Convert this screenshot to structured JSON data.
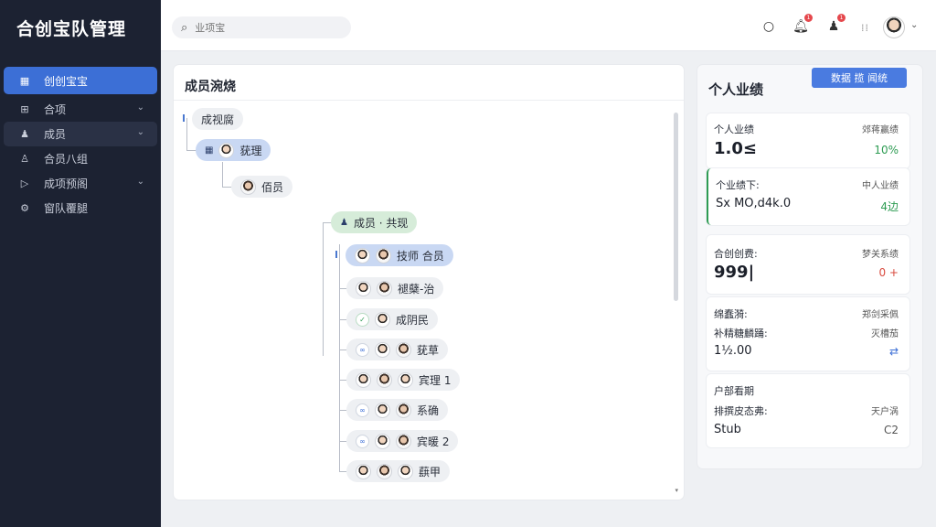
{
  "app": {
    "title": "合创宝队管理"
  },
  "sidebar": {
    "items": [
      {
        "label": "创创宝宝",
        "icon": "grid-icon"
      },
      {
        "label": "合项",
        "icon": "table-icon"
      },
      {
        "label": "成员",
        "icon": "person-icon"
      },
      {
        "label": "合员八组",
        "icon": "user-icon"
      },
      {
        "label": "成项预阁",
        "icon": "play-icon"
      },
      {
        "label": "窗队覆腿",
        "icon": "gear-icon"
      }
    ]
  },
  "topbar": {
    "search_placeholder": "业项宝",
    "bell_badge": "1",
    "user_badge": "1"
  },
  "main": {
    "title": "成员涴烧",
    "nodes": {
      "root": "成视腐",
      "lead": "莸理",
      "member": "佰员",
      "group": "成员 · 共现",
      "g0": "技师 合员",
      "g1": "褪蘖-治",
      "g2": "成阴民",
      "g3": "莸草",
      "g4": "宾理 1",
      "g5": "系确",
      "g6": "宾暖 2",
      "g7": "蕻甲"
    }
  },
  "right": {
    "title": "个人业绩",
    "button": "数据 揽 闻统",
    "cards": [
      {
        "label": "个人业绩",
        "rlabel": "郊蒋赢绩",
        "value": "1.0≤",
        "rvalue": "10%"
      },
      {
        "label": "个业绩下:",
        "rlabel": "中人业绩",
        "value": "Sx MO,d4k.0",
        "rvalue": "4边"
      },
      {
        "label": "合创创费:",
        "rlabel": "梦关系绩",
        "value": "999|",
        "rvalue": "0 +"
      },
      {
        "label": "绵蠢漪:",
        "rlabel": "郑剑采佩",
        "label2": "补精糖麟踊:",
        "rlabel2": "灭槽茄",
        "value": "1½.00",
        "rvalue": "⇄"
      },
      {
        "label": "户部看期",
        "label2": "排撰皮态弗:",
        "rlabel2": "天户涡",
        "value": "Stub",
        "rvalue": "C2"
      }
    ]
  },
  "colors": {
    "accent": "#3c6fd6",
    "sidebar": "#1c2232",
    "positive": "#2e9c53",
    "negative": "#d94b3f"
  }
}
